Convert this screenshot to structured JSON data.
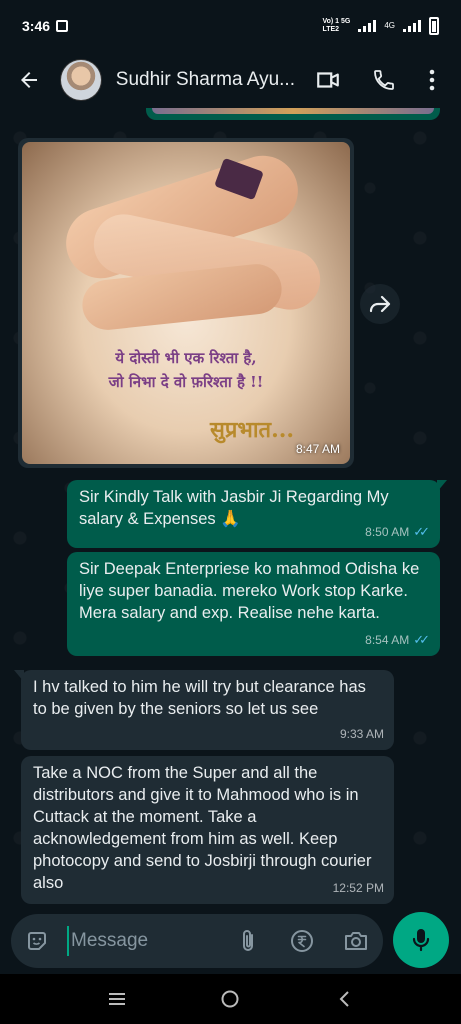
{
  "status_bar": {
    "time": "3:46",
    "network_top": "Vo) 1 5G",
    "network_bottom": "LTE2",
    "network2": "4G"
  },
  "header": {
    "contact_name": "Sudhir Sharma Ayu...",
    "icons": [
      "back-arrow-icon",
      "video-call-icon",
      "voice-call-icon",
      "more-options-icon"
    ]
  },
  "messages": [
    {
      "type": "image",
      "direction": "incoming",
      "image_text_line1": "ये दोस्ती भी एक रिश्ता है,",
      "image_text_line2": "जो निभा दे वो फ़रिश्ता है !!",
      "image_text_word": "सुप्रभात...",
      "time": "8:47 AM"
    },
    {
      "type": "text",
      "direction": "outgoing",
      "text": "Sir Kindly Talk with Jasbir Ji Regarding My  salary & Expenses 🙏",
      "time": "8:50 AM",
      "status": "read"
    },
    {
      "type": "text",
      "direction": "outgoing",
      "text": "Sir Deepak Enterpriese ko mahmod Odisha ke liye super banadia. mereko Work stop Karke. Mera salary  and exp. Realise nehe karta.",
      "time": "8:54 AM",
      "status": "read"
    },
    {
      "type": "text",
      "direction": "incoming",
      "text": "I hv talked to him he will try but clearance has to be given by the seniors so let us see",
      "time": "9:33 AM"
    },
    {
      "type": "text",
      "direction": "incoming",
      "text": "Take a NOC from the Super and all the distributors and give it to Mahmood who is in Cuttack at the moment. Take a acknowledgement from him as well. Keep photocopy and send to Josbirji through courier also",
      "time": "12:52 PM"
    }
  ],
  "composer": {
    "placeholder": "Message",
    "value": ""
  },
  "colors": {
    "background": "#0b141a",
    "outgoing_bubble": "#005c4b",
    "incoming_bubble": "#1f2c34",
    "accent": "#00a884",
    "read_ticks": "#53bdeb"
  }
}
